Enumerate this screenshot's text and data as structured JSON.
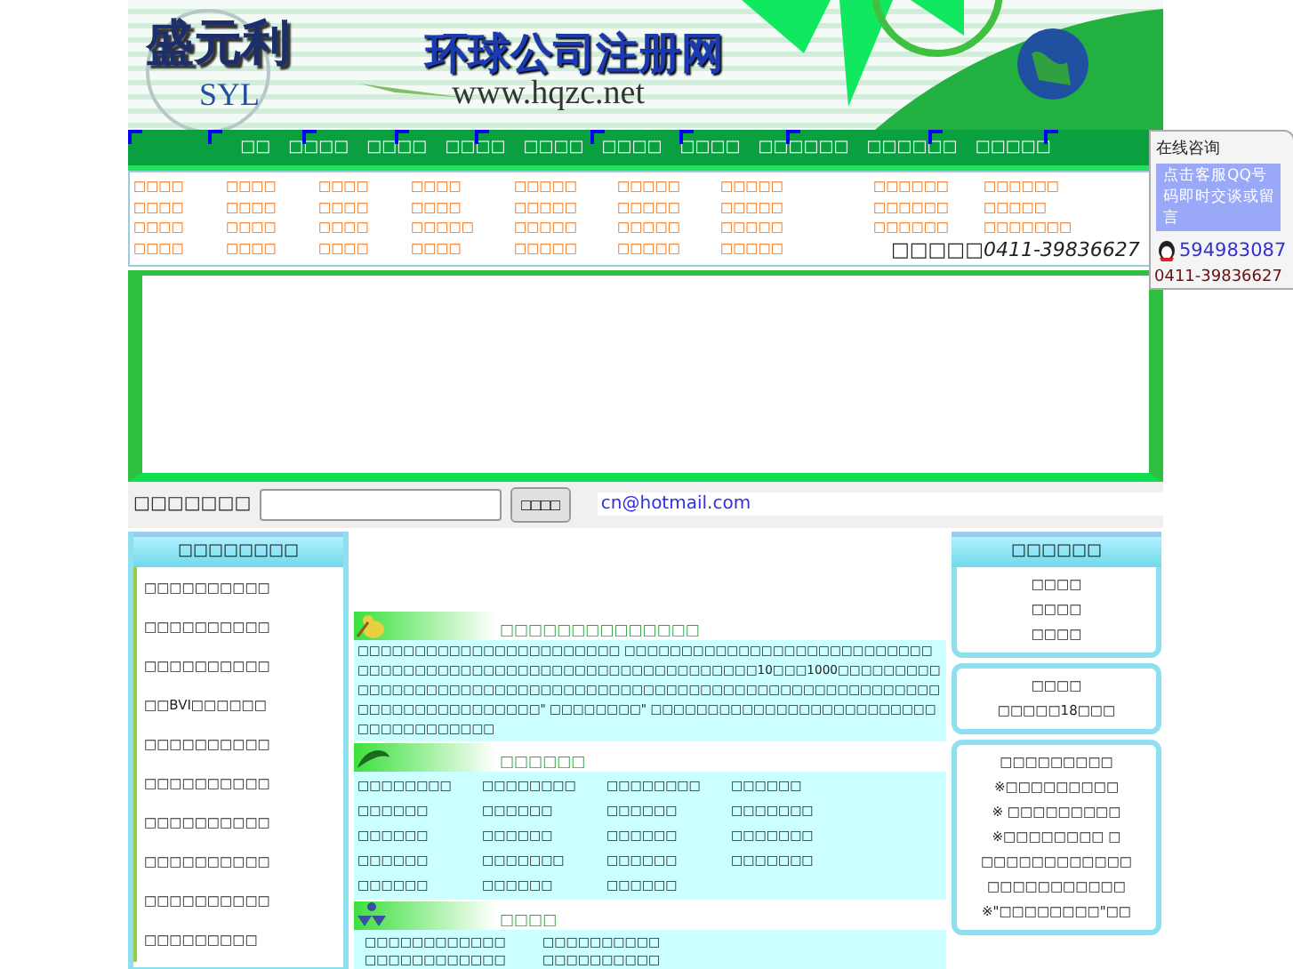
{
  "banner": {
    "logo": "盛元利",
    "logo_sub": "SYL",
    "title": "环球公司注册网",
    "url": "www.hqzc.net"
  },
  "nav": [
    "□□",
    "□□□□",
    "□□□□",
    "□□□□",
    "□□□□",
    "□□□□",
    "□□□□",
    "□□□□□□",
    "□□□□□□",
    "□□□□□"
  ],
  "links": [
    [
      "□□□□",
      "□□□□",
      "□□□□",
      "□□□□",
      "□□□□□",
      "□□□□□",
      "□□□□□",
      "□□□□□□",
      "□□□□□□"
    ],
    [
      "□□□□",
      "□□□□",
      "□□□□",
      "□□□□",
      "□□□□□",
      "□□□□□",
      "□□□□□",
      "□□□□□□",
      "□□□□□"
    ],
    [
      "□□□□",
      "□□□□",
      "□□□□",
      "□□□□□",
      "□□□□□",
      "□□□□□",
      "□□□□□",
      "□□□□□□",
      "□□□□□□□"
    ],
    [
      "□□□□",
      "□□□□",
      "□□□□",
      "□□□□",
      "□□□□□",
      "□□□□□",
      "□□□□□"
    ]
  ],
  "phone": {
    "label": "□□□□□",
    "number": "0411-39836627"
  },
  "search": {
    "label": "□□□□□□□",
    "button": "□□□□",
    "email": "cn@hotmail.com"
  },
  "left": {
    "title": "□□□□□□□□",
    "items": [
      "□□□□□□□□□□",
      "□□□□□□□□□□",
      "□□□□□□□□□□",
      "□□BVI□□□□□□",
      "□□□□□□□□□□",
      "□□□□□□□□□□",
      "□□□□□□□□□□",
      "□□□□□□□□□□",
      "□□□□□□□□□□",
      "□□□□□□□□□"
    ]
  },
  "center": [
    {
      "kind": "text",
      "title": "□□□□□□□□□□□□□□",
      "text": "□□□□□□□□□□□□□□□□□□□□□□□ □□□□□□□□□□□□□□□□□□□□□□□□□□□□□□□□□□□□□□□□□□□□□□□□□□□□□□□□□□□□□□10□□□1000□□□□□□□□□□□□□□□□□□□□□□□□□□□□□□□□□□□□□□□□□□□□□□□□□□□□□□□□□□□□□□□□□□□□□□□□□□□□\" □□□□□□□□\" □□□□□□□□□□□□□□□□□□□□□□□□□□□□□□□□□□□□□"
    },
    {
      "kind": "grid",
      "title": "□□□□□□",
      "items": [
        "□□□□□□□□",
        "□□□□□□□□",
        "□□□□□□□□",
        "□□□□□□",
        "□□□□□□",
        "□□□□□□",
        "□□□□□□",
        "□□□□□□□",
        "□□□□□□",
        "□□□□□□",
        "□□□□□□",
        "□□□□□□□",
        "□□□□□□",
        "□□□□□□□",
        "□□□□□□",
        "□□□□□□□",
        "□□□□□□",
        "□□□□□□",
        "□□□□□□"
      ]
    },
    {
      "kind": "list",
      "title": "□□□□",
      "items": [
        "□□□□□□□□□□□□",
        "□□□□□□□□□□",
        "□□□□□□□□□□□□",
        "□□□□□□□□□□"
      ]
    }
  ],
  "right": [
    {
      "title": "□□□□□□",
      "lines": [
        "□□□□",
        "□□□□",
        "□□□□"
      ]
    },
    {
      "lines": [
        "□□□□",
        "□□□□□18□□□"
      ]
    },
    {
      "lines": [
        "□□□□□□□□□",
        "※□□□□□□□□□",
        "※ □□□□□□□□□",
        "※□□□□□□□□ □",
        "□□□□□□□□□□□□",
        "□□□□□□□□□□□",
        "※\"□□□□□□□□\"□□"
      ]
    }
  ],
  "float": {
    "title": "在线咨询",
    "prompt": "点击客服QQ号码即时交谈或留言",
    "qq": "594983087",
    "phone": "0411-39836627"
  }
}
